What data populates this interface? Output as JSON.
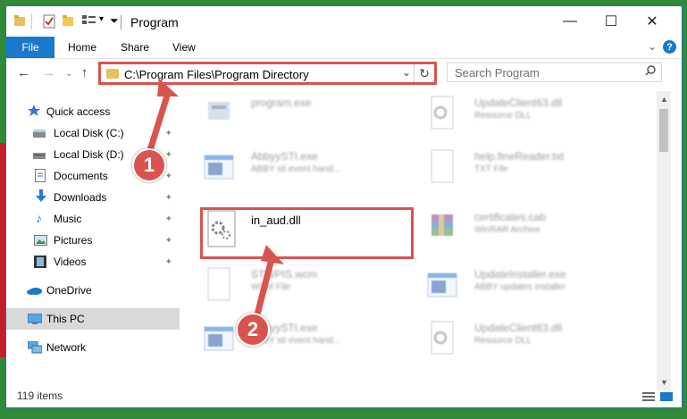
{
  "window": {
    "title": "Program",
    "controls": {
      "minimize": "—",
      "maximize": "☐",
      "close": "✕"
    }
  },
  "ribbon": {
    "tabs": [
      "File",
      "Home",
      "Share",
      "View"
    ],
    "expand": "⌄",
    "help": "?"
  },
  "address_bar": {
    "path": "C:\\Program Files\\Program Directory",
    "dropdown": "⌄",
    "refresh": "↻"
  },
  "search": {
    "placeholder": "Search Program",
    "icon": "search-icon"
  },
  "sidebar": {
    "items": [
      {
        "label": "Quick access",
        "icon": "star-icon",
        "pinned": false
      },
      {
        "label": "Local Disk (C:)",
        "icon": "drive-icon",
        "pinned": true
      },
      {
        "label": "Local Disk (D:)",
        "icon": "drive-icon",
        "pinned": true
      },
      {
        "label": "Documents",
        "icon": "documents-icon",
        "pinned": true
      },
      {
        "label": "Downloads",
        "icon": "downloads-icon",
        "pinned": true
      },
      {
        "label": "Music",
        "icon": "music-icon",
        "pinned": true
      },
      {
        "label": "Pictures",
        "icon": "pictures-icon",
        "pinned": true
      },
      {
        "label": "Videos",
        "icon": "videos-icon",
        "pinned": true
      },
      {
        "label": "OneDrive",
        "icon": "onedrive-icon",
        "pinned": false
      },
      {
        "label": "This PC",
        "icon": "computer-icon",
        "pinned": false,
        "selected": true
      },
      {
        "label": "Network",
        "icon": "network-icon",
        "pinned": false
      }
    ],
    "pin_glyph": "📌"
  },
  "files": [
    {
      "name": "program.exe",
      "desc": "",
      "icon": "exe-icon"
    },
    {
      "name": "UpdateClient63.dll",
      "desc": "Resource DLL",
      "icon": "dll-icon"
    },
    {
      "name": "AbbyySTI.exe",
      "desc": "ABBY sti event hand...",
      "icon": "exe-window-icon"
    },
    {
      "name": "help.fineReader.txt",
      "desc": "TXT File",
      "icon": "txt-icon"
    },
    {
      "name": "in_aud.dll",
      "desc": "",
      "icon": "dll-gear-icon",
      "highlighted": true
    },
    {
      "name": "certificates.cab",
      "desc": "WinRAR Archive",
      "icon": "winrar-icon"
    },
    {
      "name": "STWPIS.wcm",
      "desc": "WCM File",
      "icon": "file-icon"
    },
    {
      "name": "UpdateInstaller.exe",
      "desc": "ABBY updates installer",
      "icon": "exe-window-icon"
    },
    {
      "name": "AbbyySTI.exe",
      "desc": "ABBY sti event hand...",
      "icon": "exe-window-icon"
    },
    {
      "name": "UpdateClient63.dll",
      "desc": "Resource DLL",
      "icon": "dll-icon"
    }
  ],
  "status": {
    "count": "119 items"
  },
  "annotations": {
    "step1": "1",
    "step2": "2",
    "color": "#d9534f"
  },
  "colors": {
    "accent": "#1979ca",
    "highlight_border": "#d9534f"
  }
}
